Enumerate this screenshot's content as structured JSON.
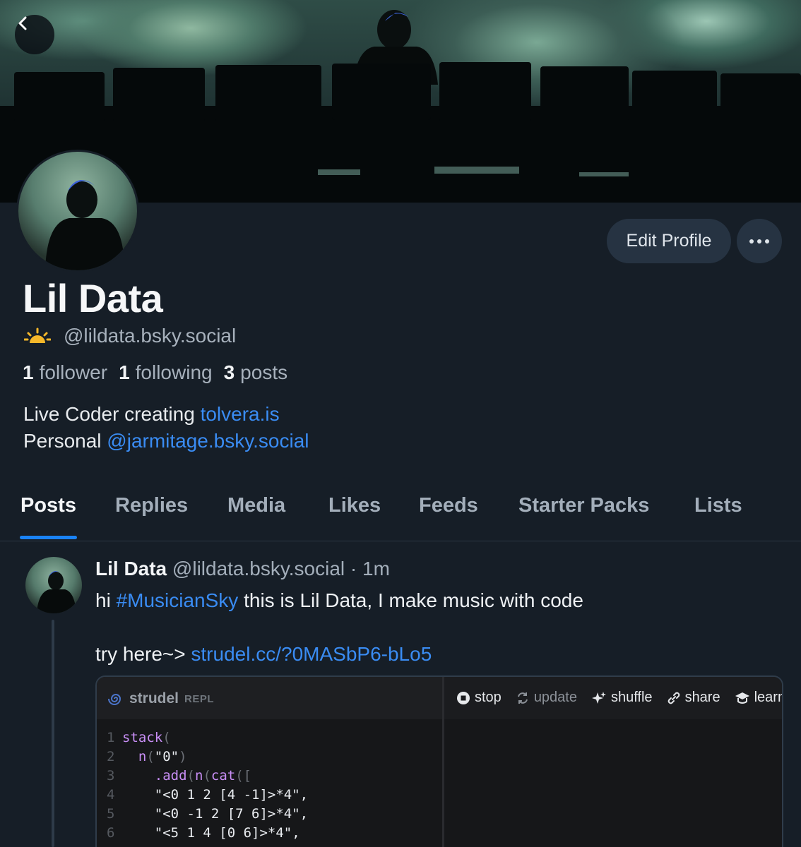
{
  "profile": {
    "display_name": "Lil Data",
    "handle": "@lildata.bsky.social",
    "edit_label": "Edit Profile",
    "more_label": "···",
    "stats": {
      "followers_count": "1",
      "followers_label": "follower",
      "following_count": "1",
      "following_label": "following",
      "posts_count": "3",
      "posts_label": "posts"
    },
    "bio": {
      "line1_prefix": "Live Coder creating ",
      "line1_link": "tolvera.is",
      "line2_prefix": "Personal ",
      "line2_link": "@jarmitage.bsky.social"
    }
  },
  "tabs": [
    "Posts",
    "Replies",
    "Media",
    "Likes",
    "Feeds",
    "Starter Packs",
    "Lists"
  ],
  "active_tab": "Posts",
  "post": {
    "author": "Lil Data",
    "handle": "@lildata.bsky.social",
    "separator": " · ",
    "time": "1m",
    "line1_prefix": "hi ",
    "hashtag": "#MusicianSky",
    "line1_suffix": " this is Lil Data, I make music with code",
    "line2_prefix": "try here~> ",
    "link": "strudel.cc/?0MASbP6-bLo5"
  },
  "embed": {
    "app_name": "strudel",
    "app_sub": "REPL",
    "toolbar": [
      "stop",
      "update",
      "shuffle",
      "share",
      "learn"
    ],
    "code_lines": [
      {
        "n": "1",
        "text": "stack("
      },
      {
        "n": "2",
        "text": "  n(\"0\")"
      },
      {
        "n": "3",
        "text": "    .add(n(cat(["
      },
      {
        "n": "4",
        "text": "    \"<0 1 2 [4 -1]>*4\","
      },
      {
        "n": "5",
        "text": "    \"<0 -1 2 [7 6]>*4\","
      },
      {
        "n": "6",
        "text": "    \"<5 1 4 [0 6]>*4\","
      }
    ]
  },
  "colors": {
    "background": "#161e27",
    "accent": "#1a83f5",
    "link": "#3a8cf3",
    "button_bg": "#263342",
    "muted_text": "#a7b1bc"
  },
  "icons": {
    "back": "chevron-left-icon",
    "handle_badge": "sunrise-icon",
    "more": "ellipsis-icon"
  }
}
